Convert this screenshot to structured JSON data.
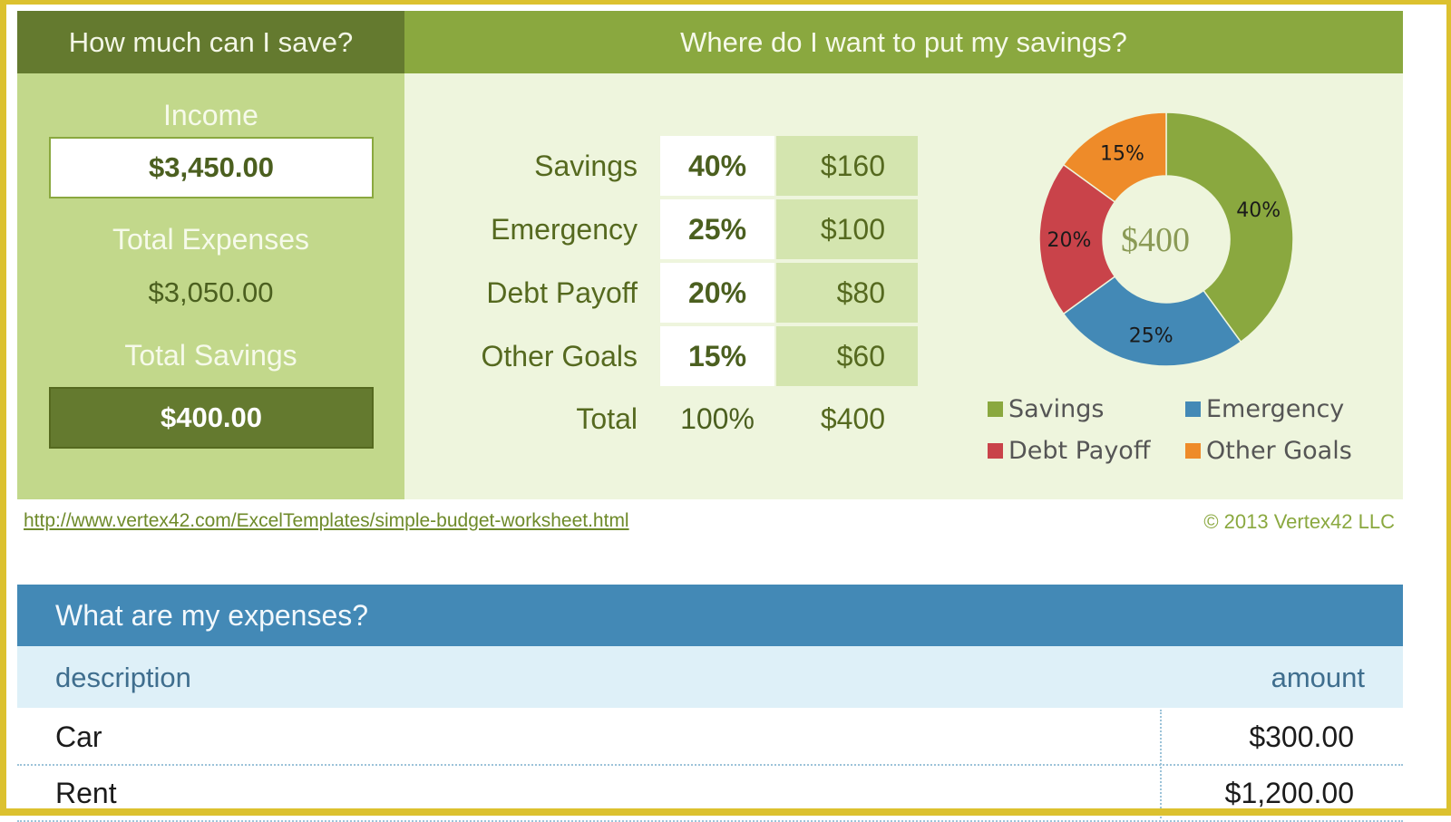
{
  "savings_calc": {
    "title": "How much can I save?",
    "income_label": "Income",
    "income_value": "$3,450.00",
    "expenses_label": "Total Expenses",
    "expenses_value": "$3,050.00",
    "savings_label": "Total Savings",
    "savings_value": "$400.00"
  },
  "allocation": {
    "title": "Where do I want to put my savings?",
    "rows": [
      {
        "name": "Savings",
        "pct": "40%",
        "amount": "$160"
      },
      {
        "name": "Emergency",
        "pct": "25%",
        "amount": "$100"
      },
      {
        "name": "Debt Payoff",
        "pct": "20%",
        "amount": "$80"
      },
      {
        "name": "Other Goals",
        "pct": "15%",
        "amount": "$60"
      }
    ],
    "total": {
      "name": "Total",
      "pct": "100%",
      "amount": "$400"
    }
  },
  "chart_data": {
    "type": "pie",
    "subtype": "donut",
    "center_label": "$400",
    "categories": [
      "Savings",
      "Emergency",
      "Debt Payoff",
      "Other Goals"
    ],
    "values": [
      40,
      25,
      20,
      15
    ],
    "data_labels": [
      "40%",
      "25%",
      "20%",
      "15%"
    ],
    "colors": [
      "#8aa83f",
      "#4389b6",
      "#c9434a",
      "#ee8b29"
    ],
    "legend": [
      "Savings",
      "Emergency",
      "Debt Payoff",
      "Other Goals"
    ],
    "legend_position": "bottom"
  },
  "footer": {
    "url_link": "http://www.vertex42.com/ExcelTemplates/simple-budget-worksheet.html",
    "copyright": "© 2013 Vertex42 LLC"
  },
  "expenses": {
    "title": "What are my expenses?",
    "columns": {
      "description": "description",
      "amount": "amount"
    },
    "rows": [
      {
        "description": "Car",
        "amount": "$300.00"
      },
      {
        "description": "Rent",
        "amount": "$1,200.00"
      }
    ]
  }
}
